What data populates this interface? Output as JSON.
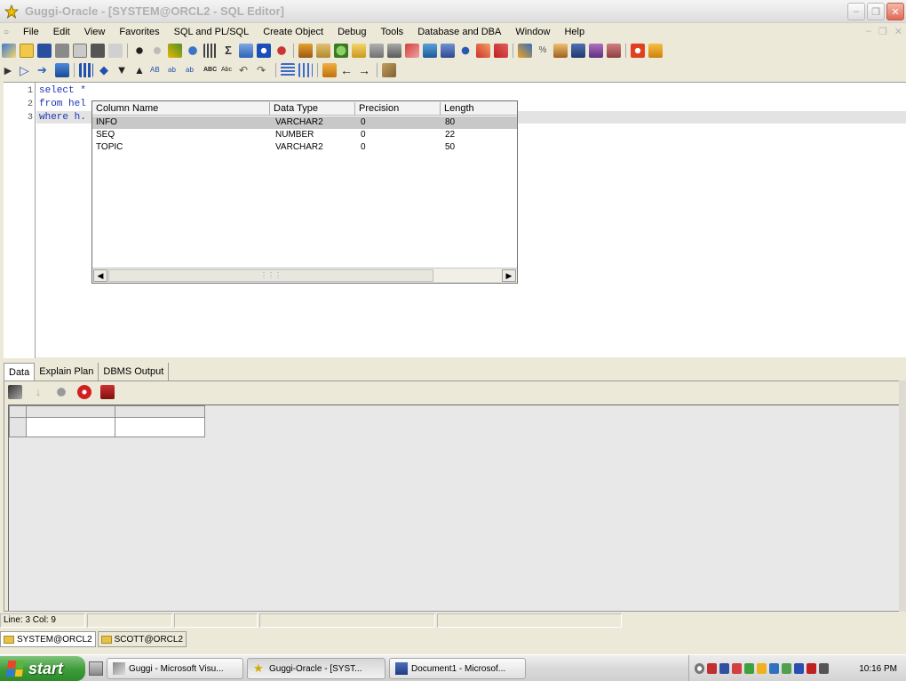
{
  "window": {
    "title": "Guggi-Oracle - [SYSTEM@ORCL2 - SQL Editor]"
  },
  "menu": [
    "File",
    "Edit",
    "View",
    "Favorites",
    "SQL and PL/SQL",
    "Create Object",
    "Debug",
    "Tools",
    "Database and DBA",
    "Window",
    "Help"
  ],
  "editor": {
    "lines": [
      {
        "num": "1",
        "text": "select *"
      },
      {
        "num": "2",
        "text": "from hel"
      },
      {
        "num": "3",
        "text": "where h."
      }
    ]
  },
  "column_popup": {
    "headers": [
      "Column Name",
      "Data Type",
      "Precision",
      "Length"
    ],
    "rows": [
      {
        "name": "INFO",
        "type": "VARCHAR2",
        "precision": "0",
        "length": "80"
      },
      {
        "name": "SEQ",
        "type": "NUMBER",
        "precision": "0",
        "length": "22"
      },
      {
        "name": "TOPIC",
        "type": "VARCHAR2",
        "precision": "0",
        "length": "50"
      }
    ],
    "selected_row": "INFO"
  },
  "result_tabs": [
    "Data",
    "Explain Plan",
    "DBMS Output"
  ],
  "status": {
    "position": "Line: 3 Col: 9"
  },
  "connections": [
    "SYSTEM@ORCL2",
    "SCOTT@ORCL2"
  ],
  "taskbar": {
    "start_label": "start",
    "tasks": [
      "Guggi - Microsoft Visu...",
      "Guggi-Oracle - [SYST...",
      "Document1 - Microsof..."
    ],
    "clock": "10:16 PM"
  }
}
